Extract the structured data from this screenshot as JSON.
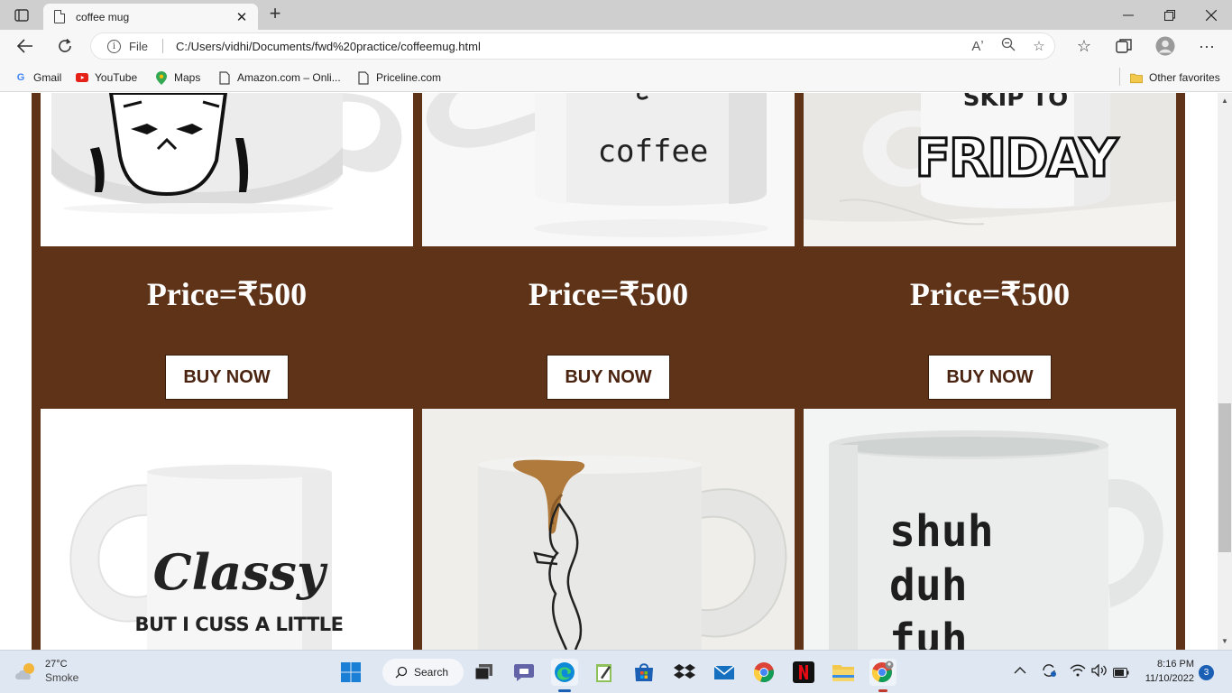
{
  "browser": {
    "tab_title": "coffee mug",
    "address_scheme": "File",
    "address_url": "C:/Users/vidhi/Documents/fwd%20practice/coffeemug.html",
    "bookmarks": [
      {
        "label": "Gmail",
        "icon": "gmail-icon"
      },
      {
        "label": "YouTube",
        "icon": "youtube-icon"
      },
      {
        "label": "Maps",
        "icon": "maps-icon"
      },
      {
        "label": "Amazon.com – Onli...",
        "icon": "page-icon"
      },
      {
        "label": "Priceline.com",
        "icon": "page-icon"
      }
    ],
    "other_favorites": "Other favorites"
  },
  "page": {
    "background_color": "#5f3318",
    "mug_texts": {
      "coffee": "coffee",
      "skip_to": "SKIP TO",
      "friday": "FRIDAY",
      "classy": "Classy",
      "cuss": "BUT I CUSS A LITTLE",
      "shuh": "shuh",
      "duh": "duh",
      "fuh": "fuh"
    },
    "products": [
      {
        "price": "Price=₹500",
        "button": "BUY NOW"
      },
      {
        "price": "Price=₹500",
        "button": "BUY NOW"
      },
      {
        "price": "Price=₹500",
        "button": "BUY NOW"
      }
    ]
  },
  "taskbar": {
    "weather_temp": "27°C",
    "weather_desc": "Smoke",
    "search_label": "Search",
    "time": "8:16 PM",
    "date": "11/10/2022",
    "notification_count": "3"
  }
}
